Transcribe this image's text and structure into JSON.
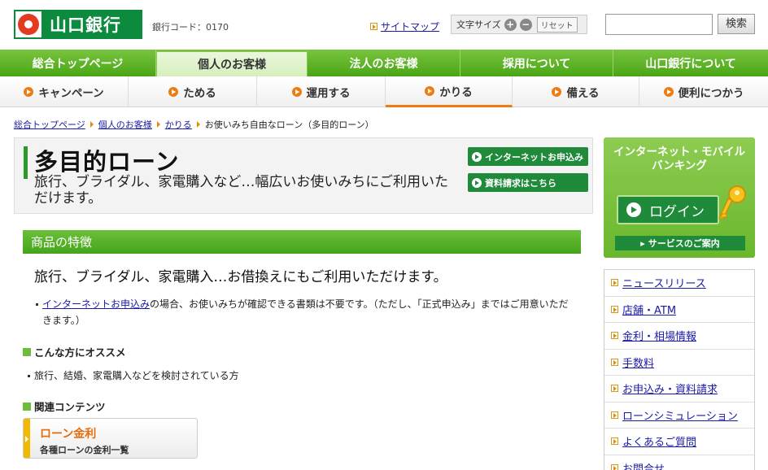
{
  "header": {
    "logo_text": "山口銀行",
    "bank_code": "銀行コード：0170",
    "sitemap_label": "サイトマップ",
    "fontsize_label": "文字サイズ",
    "fontsize_plus": "+",
    "fontsize_minus": "−",
    "reset_label": "リセット",
    "search_placeholder": "",
    "search_button": "検索"
  },
  "global_nav": [
    {
      "label": "総合トップページ",
      "active": false
    },
    {
      "label": "個人のお客様",
      "active": true
    },
    {
      "label": "法人のお客様",
      "active": false
    },
    {
      "label": "採用について",
      "active": false
    },
    {
      "label": "山口銀行について",
      "active": false
    }
  ],
  "sub_nav": [
    {
      "label": "キャンペーン"
    },
    {
      "label": "ためる"
    },
    {
      "label": "運用する"
    },
    {
      "label": "かりる",
      "active": true
    },
    {
      "label": "備える"
    },
    {
      "label": "便利につかう"
    }
  ],
  "breadcrumb": {
    "items": [
      "総合トップページ",
      "個人のお客様",
      "かりる"
    ],
    "current": "お使いみち自由なローン（多目的ローン）"
  },
  "title_box": {
    "title": "多目的ローン",
    "subtitle": "旅行、ブライダル、家電購入など…幅広いお使いみちにご利用いただけます。",
    "btn_internet": "インターネットお申込み",
    "btn_request": "資料請求はこちら"
  },
  "features": {
    "heading": "商品の特徴",
    "main_text": "旅行、ブライダル、家電購入…お借換えにもご利用いただけます。",
    "note_link": "インターネットお申込み",
    "note_text": "の場合、お使いみちが確認できる書類は不要です。（ただし、「正式申込み」まではご用意いただきます。）",
    "recommend_heading": "こんな方にオススメ",
    "recommend_item": "旅行、結婚、家電購入などを検討されている方",
    "related_heading": "関連コンテンツ",
    "related_title": "ローン金利",
    "related_sub": "各種ローンの金利一覧"
  },
  "sidebar": {
    "ib_title_1": "インターネット・モバイル",
    "ib_title_2": "バンキング",
    "login_label": "ログイン",
    "service_label": "サービスのご案内",
    "links": [
      "ニュースリリース",
      "店舗・ATM",
      "金利・相場情報",
      "手数料",
      "お申込み・資料請求",
      "ローンシミュレーション",
      "よくあるご質問",
      "お問合せ"
    ]
  },
  "colors": {
    "brand_green": "#0c8a3e",
    "nav_green": "#4aa516",
    "accent_orange": "#ee7c13"
  }
}
